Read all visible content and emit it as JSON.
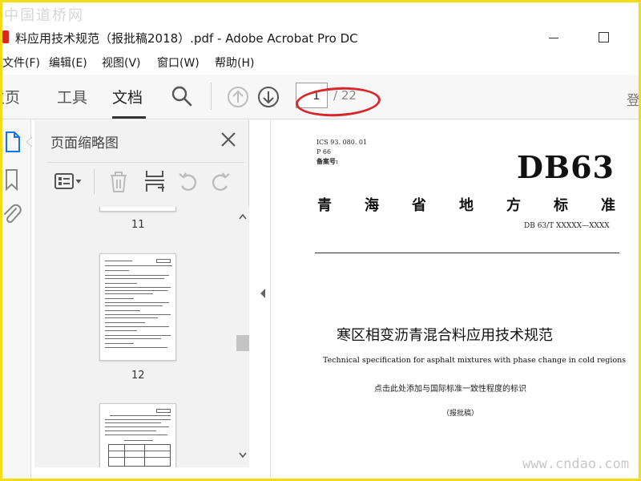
{
  "watermark_top": "中国道桥网",
  "watermark_bottom": "www.cndao.com",
  "window": {
    "title": "料应用技术规范（报批稿2018）.pdf - Adobe Acrobat Pro DC"
  },
  "menu": [
    "文件(F)",
    "编辑(E)",
    "视图(V)",
    "窗口(W)",
    "帮助(H)"
  ],
  "toolbar": {
    "tabs": [
      "主页",
      "工具",
      "文档"
    ],
    "active_tab": "文档",
    "page_current": "1",
    "page_total": "/ 22",
    "right_clip": "登"
  },
  "panel": {
    "title": "页面缩略图",
    "thumbnails": [
      {
        "label": "11"
      },
      {
        "label": "12"
      }
    ]
  },
  "document": {
    "ics": "ICS 93. 080. 01",
    "p_code": "P 66",
    "record_no": "备案号:",
    "db_code": "DB63",
    "region_chars": [
      "青",
      "海",
      "省",
      "地",
      "方",
      "标",
      "准"
    ],
    "std_number": "DB 63/T  XXXXX—XXXX",
    "cn_title": "寒区相变沥青混合料应用技术规范",
    "en_title": "Technical specification for asphalt mixtures with phase change in cold regions",
    "consistency_note": "点击此处添加与国际标准一致性程度的标识",
    "draft_label": "（报批稿）"
  },
  "colors": {
    "frame_border": "#f4dc12",
    "annotation_ellipse": "#d8262c",
    "acrobat_red": "#e1251b"
  }
}
